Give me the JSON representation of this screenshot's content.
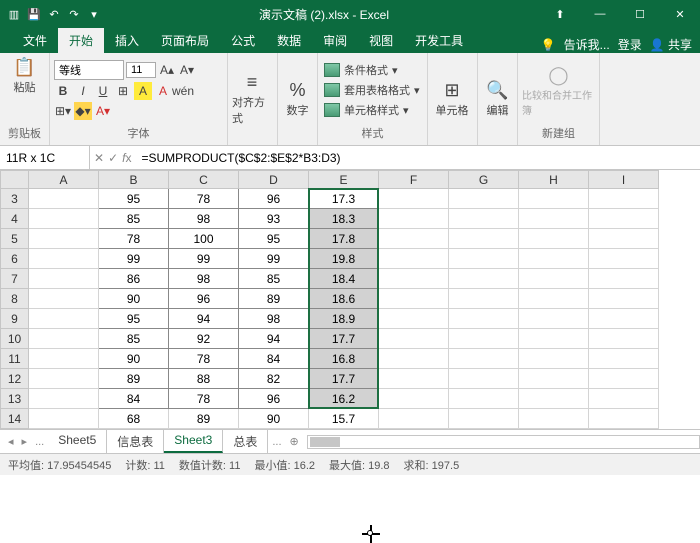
{
  "titlebar": {
    "title": "演示文稿 (2).xlsx - Excel"
  },
  "wincontrols": {
    "min": "—",
    "max": "☐",
    "close": "✕",
    "ribbonmin": "⬆"
  },
  "tabs": {
    "items": [
      "文件",
      "开始",
      "插入",
      "页面布局",
      "公式",
      "数据",
      "审阅",
      "视图",
      "开发工具"
    ],
    "active": 1,
    "tellme": "告诉我...",
    "login": "登录",
    "share": "共享"
  },
  "ribbon": {
    "clipboard": {
      "paste": "粘贴",
      "label": "剪贴板"
    },
    "font": {
      "name": "等线",
      "size": "11",
      "label": "字体"
    },
    "align": {
      "btn": "对齐方式",
      "label": ""
    },
    "number": {
      "btn": "数字",
      "label": ""
    },
    "styles": {
      "cond": "条件格式",
      "tblfmt": "套用表格格式",
      "cellstyle": "单元格样式",
      "label": "样式"
    },
    "cells": {
      "btn": "单元格"
    },
    "editing": {
      "btn": "编辑"
    },
    "new": {
      "btn": "比较和合并工作簿",
      "label": "新建组"
    }
  },
  "formulabar": {
    "namebox": "11R x 1C",
    "formula": "=SUMPRODUCT($C$2:$E$2*B3:D3)"
  },
  "cols": [
    "A",
    "B",
    "C",
    "D",
    "E",
    "F",
    "G",
    "H",
    "I"
  ],
  "rows": [
    {
      "n": 3,
      "b": "95",
      "c": "78",
      "d": "96",
      "e": "17.3"
    },
    {
      "n": 4,
      "b": "85",
      "c": "98",
      "d": "93",
      "e": "18.3"
    },
    {
      "n": 5,
      "b": "78",
      "c": "100",
      "d": "95",
      "e": "17.8"
    },
    {
      "n": 6,
      "b": "99",
      "c": "99",
      "d": "99",
      "e": "19.8"
    },
    {
      "n": 7,
      "b": "86",
      "c": "98",
      "d": "85",
      "e": "18.4"
    },
    {
      "n": 8,
      "b": "90",
      "c": "96",
      "d": "89",
      "e": "18.6"
    },
    {
      "n": 9,
      "b": "95",
      "c": "94",
      "d": "98",
      "e": "18.9"
    },
    {
      "n": 10,
      "b": "85",
      "c": "92",
      "d": "94",
      "e": "17.7"
    },
    {
      "n": 11,
      "b": "90",
      "c": "78",
      "d": "84",
      "e": "16.8"
    },
    {
      "n": 12,
      "b": "89",
      "c": "88",
      "d": "82",
      "e": "17.7"
    },
    {
      "n": 13,
      "b": "84",
      "c": "78",
      "d": "96",
      "e": "16.2"
    },
    {
      "n": 14,
      "b": "68",
      "c": "89",
      "d": "90",
      "e": "15.7"
    }
  ],
  "sheets": {
    "items": [
      "Sheet5",
      "信息表",
      "Sheet3",
      "总表"
    ],
    "active": 2,
    "more": "..."
  },
  "statusbar": {
    "avg_lbl": "平均值:",
    "avg": "17.95454545",
    "cnt_lbl": "计数:",
    "cnt": "11",
    "ncnt_lbl": "数值计数:",
    "ncnt": "11",
    "min_lbl": "最小值:",
    "min": "16.2",
    "max_lbl": "最大值:",
    "max": "19.8",
    "sum_lbl": "求和:",
    "sum": "197.5"
  }
}
